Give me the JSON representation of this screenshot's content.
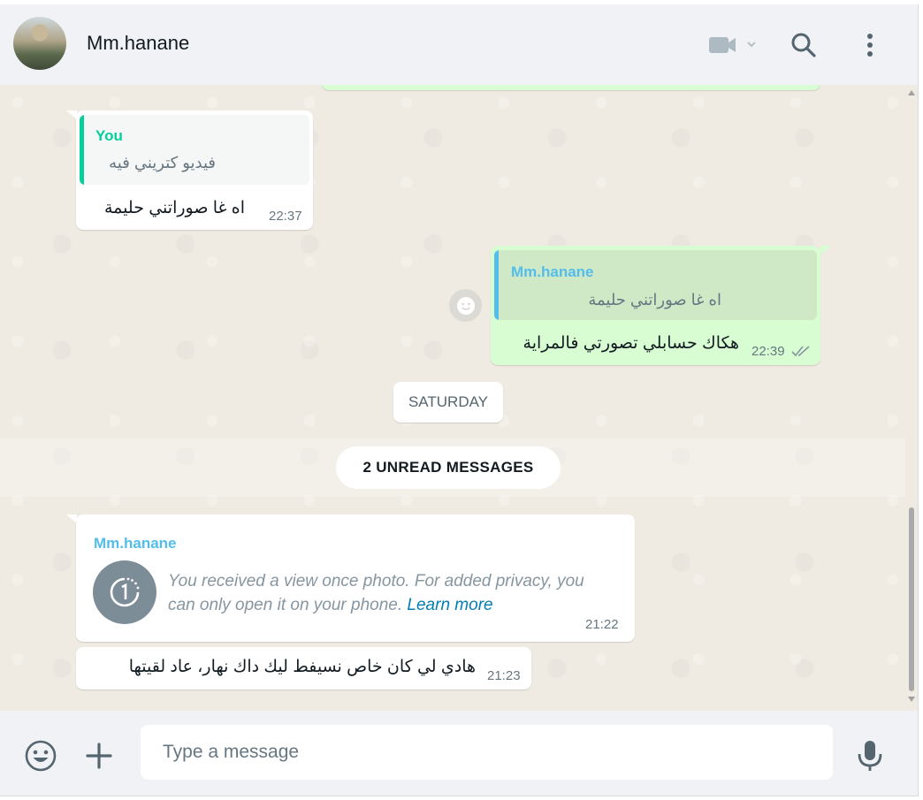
{
  "header": {
    "contact_name": "Mm.hanane",
    "icons": [
      "video-call-icon",
      "chevron-down-icon",
      "search-icon",
      "menu-icon"
    ]
  },
  "messages": [
    {
      "direction": "in",
      "quote_author": "You",
      "quote_text": "فيديو كتريني فيه",
      "text": "اه غا صوراتني حليمة",
      "time": "22:37"
    },
    {
      "direction": "out",
      "quote_author": "Mm.hanane",
      "quote_text": "اه غا صوراتني حليمة",
      "text": "هكاك حسابلي تصورتي فالمراية",
      "time": "22:39",
      "status": "read"
    }
  ],
  "day_separator": "SATURDAY",
  "unread_label": "2 UNREAD MESSAGES",
  "view_once": {
    "sender": "Mm.hanane",
    "text": "You received a view once photo. For added privacy, you can only open it on your phone.",
    "link": "Learn more",
    "time": "21:22"
  },
  "last_message": {
    "text": "هادي لي كان خاص نسيفط ليك داك نهار، عاد لقيتها",
    "time": "21:23"
  },
  "composer": {
    "placeholder": "Type a message"
  },
  "colors": {
    "incoming_bubble": "#ffffff",
    "outgoing_bubble": "#d9fdd3",
    "chat_background": "#efeae2",
    "quote_you": "#06cf9c",
    "quote_contact": "#53bdeb",
    "link": "#027eb5"
  }
}
